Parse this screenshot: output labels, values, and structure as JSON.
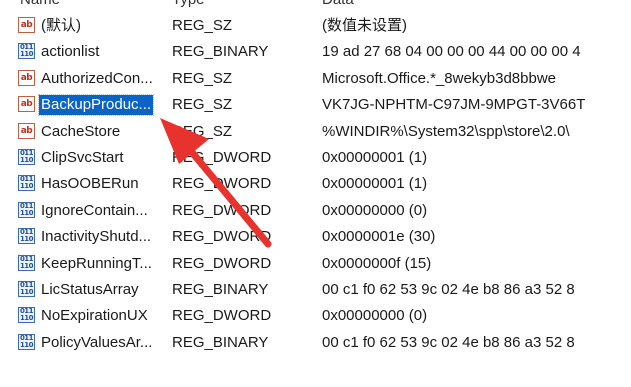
{
  "header_cut": [
    "Name",
    "Type",
    "Data"
  ],
  "rows": [
    {
      "icon": "string-value-icon",
      "kind": "sz",
      "name": "(默认)",
      "type": "REG_SZ",
      "data": "(数值未设置)"
    },
    {
      "icon": "binary-value-icon",
      "kind": "bin",
      "name": "actionlist",
      "type": "REG_BINARY",
      "data": "19 ad 27 68 04 00 00 00 44 00 00 00 4"
    },
    {
      "icon": "string-value-icon",
      "kind": "sz",
      "name": "AuthorizedCon...",
      "type": "REG_SZ",
      "data": "Microsoft.Office.*_8wekyb3d8bbwe"
    },
    {
      "icon": "string-value-icon",
      "kind": "sz",
      "name": "BackupProduc...",
      "type": "REG_SZ",
      "data": "VK7JG-NPHTM-C97JM-9MPGT-3V66T",
      "selected": true
    },
    {
      "icon": "string-value-icon",
      "kind": "sz",
      "name": "CacheStore",
      "type": "REG_SZ",
      "data": "%WINDIR%\\System32\\spp\\store\\2.0\\"
    },
    {
      "icon": "binary-value-icon",
      "kind": "bin",
      "name": "ClipSvcStart",
      "type": "REG_DWORD",
      "data": "0x00000001 (1)"
    },
    {
      "icon": "binary-value-icon",
      "kind": "bin",
      "name": "HasOOBERun",
      "type": "REG_DWORD",
      "data": "0x00000001 (1)"
    },
    {
      "icon": "binary-value-icon",
      "kind": "bin",
      "name": "IgnoreContain...",
      "type": "REG_DWORD",
      "data": "0x00000000 (0)"
    },
    {
      "icon": "binary-value-icon",
      "kind": "bin",
      "name": "InactivityShutd...",
      "type": "REG_DWORD",
      "data": "0x0000001e (30)"
    },
    {
      "icon": "binary-value-icon",
      "kind": "bin",
      "name": "KeepRunningT...",
      "type": "REG_DWORD",
      "data": "0x0000000f (15)"
    },
    {
      "icon": "binary-value-icon",
      "kind": "bin",
      "name": "LicStatusArray",
      "type": "REG_BINARY",
      "data": "00 c1 f0 62 53 9c 02 4e b8 86 a3 52 8"
    },
    {
      "icon": "binary-value-icon",
      "kind": "bin",
      "name": "NoExpirationUX",
      "type": "REG_DWORD",
      "data": "0x00000000 (0)"
    },
    {
      "icon": "binary-value-icon",
      "kind": "bin",
      "name": "PolicyValuesAr...",
      "type": "REG_BINARY",
      "data": "00 c1 f0 62 53 9c 02 4e b8 86 a3 52 8"
    }
  ],
  "icon_glyphs": {
    "sz": "ab",
    "bin": "011\n110"
  },
  "colors": {
    "selection": "#0a64c8",
    "arrow": "#e8322d"
  }
}
